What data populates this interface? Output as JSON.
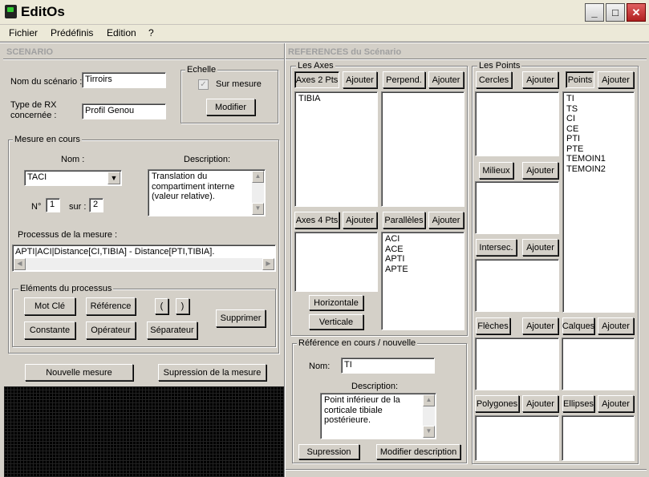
{
  "window": {
    "title": "EditOs"
  },
  "menu": [
    "Fichier",
    "Prédéfinis",
    "Edition",
    "?"
  ],
  "scenario": {
    "section_title": "SCENARIO",
    "name_label": "Nom du scénario :",
    "name_value": "Tirroirs",
    "type_label_1": "Type de RX",
    "type_label_2": "concernée :",
    "type_value": "Profil Genou",
    "echelle": {
      "label": "Echelle",
      "checkbox_label": "Sur mesure",
      "checked": true,
      "modify_button": "Modifier"
    },
    "mesure": {
      "label": "Mesure en cours",
      "nom_label": "Nom :",
      "nom_value": "TACI",
      "description_label": "Description:",
      "description_value": "Translation du compartiment interne (valeur relative).",
      "num_label": "N°",
      "num_value": "1",
      "sur_label": "sur :",
      "sur_value": "2",
      "processus_label": "Processus de la mesure :",
      "processus_value": "APTI|ACI|Distance[CI,TIBIA] - Distance[PTI,TIBIA]."
    },
    "elements": {
      "label": "Eléments du processus",
      "mot_cle": "Mot Clé",
      "reference": "Référence",
      "paren_open": "(",
      "paren_close": ")",
      "constante": "Constante",
      "operateur": "Opérateur",
      "separateur": "Séparateur",
      "supprimer": "Supprimer"
    },
    "nouvelle_mesure": "Nouvelle mesure",
    "suppression_mesure": "Supression de la mesure"
  },
  "references": {
    "section_title": "REFERENCES du Scénario",
    "axes": {
      "label": "Les Axes",
      "axes2": {
        "tab": "Axes 2 Pts",
        "add": "Ajouter",
        "items": [
          "TIBIA"
        ]
      },
      "perpend": {
        "tab": "Perpend.",
        "add": "Ajouter",
        "items": []
      },
      "axes4": {
        "tab": "Axes 4 Pts",
        "add": "Ajouter",
        "items": []
      },
      "paralleles": {
        "tab": "Parallèles",
        "add": "Ajouter",
        "items": [
          "ACI",
          "ACE",
          "APTI",
          "APTE"
        ]
      },
      "horizontale": "Horizontale",
      "verticale": "Verticale"
    },
    "points": {
      "label": "Les Points",
      "cercles": {
        "tab": "Cercles",
        "add": "Ajouter"
      },
      "points": {
        "tab": "Points",
        "add": "Ajouter",
        "items": [
          "TI",
          "TS",
          "CI",
          "CE",
          "PTI",
          "PTE",
          "TEMOIN1",
          "TEMOIN2"
        ]
      },
      "milieux": {
        "tab": "Milieux",
        "add": "Ajouter"
      },
      "intersec": {
        "tab": "Intersec.",
        "add": "Ajouter"
      },
      "fleches": {
        "tab": "Flèches",
        "add": "Ajouter"
      },
      "calques": {
        "tab": "Calques",
        "add": "Ajouter"
      },
      "polygones": {
        "tab": "Polygones",
        "add": "Ajouter"
      },
      "ellipses": {
        "tab": "Ellipses",
        "add": "Ajouter"
      }
    },
    "current": {
      "label": "Référence en cours / nouvelle",
      "nom_label": "Nom:",
      "nom_value": "TI",
      "description_label": "Description:",
      "description_value": "Point inférieur de la corticale tibiale postérieure.",
      "suppression": "Supression",
      "modifier": "Modifier description"
    }
  }
}
